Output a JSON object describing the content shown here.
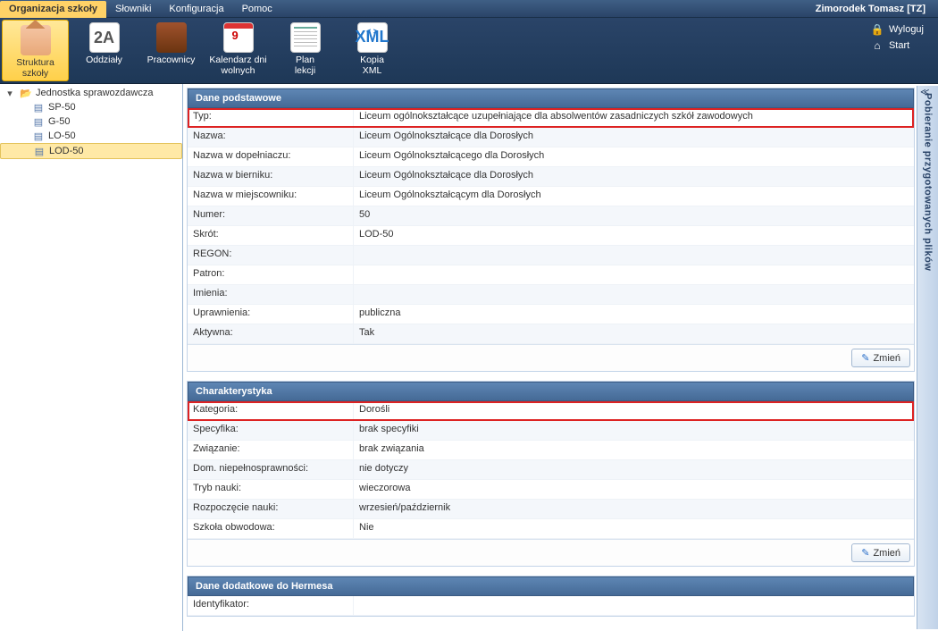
{
  "menu": {
    "tabs": [
      "Organizacja szkoły",
      "Słowniki",
      "Konfiguracja",
      "Pomoc"
    ],
    "active": 0
  },
  "user": "Zimorodek Tomasz [TZ]",
  "ribbon": {
    "buttons": [
      {
        "l1": "Struktura",
        "l2": "szkoły"
      },
      {
        "l1": "Oddziały",
        "l2": ""
      },
      {
        "l1": "Pracownicy",
        "l2": ""
      },
      {
        "l1": "Kalendarz dni",
        "l2": "wolnych"
      },
      {
        "l1": "Plan",
        "l2": "lekcji"
      },
      {
        "l1": "Kopia",
        "l2": "XML"
      }
    ],
    "links": {
      "logout": "Wyloguj",
      "start": "Start"
    }
  },
  "tree": {
    "root": "Jednostka sprawozdawcza",
    "items": [
      "SP-50",
      "G-50",
      "LO-50",
      "LOD-50"
    ],
    "selected": 3
  },
  "panels": {
    "basic": {
      "title": "Dane podstawowe",
      "rows": [
        {
          "label": "Typ:",
          "value": "Liceum ogólnokształcące uzupełniające dla absolwentów zasadniczych szkół zawodowych",
          "hl": true
        },
        {
          "label": "Nazwa:",
          "value": "Liceum Ogólnokształcące dla Dorosłych"
        },
        {
          "label": "Nazwa w dopełniaczu:",
          "value": "Liceum Ogólnokształcącego dla Dorosłych"
        },
        {
          "label": "Nazwa w bierniku:",
          "value": "Liceum Ogólnokształcące dla Dorosłych"
        },
        {
          "label": "Nazwa w miejscowniku:",
          "value": "Liceum Ogólnokształcącym dla Dorosłych"
        },
        {
          "label": "Numer:",
          "value": "50"
        },
        {
          "label": "Skrót:",
          "value": "LOD-50"
        },
        {
          "label": "REGON:",
          "value": ""
        },
        {
          "label": "Patron:",
          "value": ""
        },
        {
          "label": "Imienia:",
          "value": ""
        },
        {
          "label": "Uprawnienia:",
          "value": "publiczna"
        },
        {
          "label": "Aktywna:",
          "value": "Tak"
        }
      ],
      "button": "Zmień"
    },
    "char": {
      "title": "Charakterystyka",
      "rows": [
        {
          "label": "Kategoria:",
          "value": "Dorośli",
          "hl": true
        },
        {
          "label": "Specyfika:",
          "value": "brak specyfiki"
        },
        {
          "label": "Związanie:",
          "value": "brak związania"
        },
        {
          "label": "Dom. niepełnosprawności:",
          "value": "nie dotyczy"
        },
        {
          "label": "Tryb nauki:",
          "value": "wieczorowa"
        },
        {
          "label": "Rozpoczęcie nauki:",
          "value": "wrzesień/październik"
        },
        {
          "label": "Szkoła obwodowa:",
          "value": "Nie"
        }
      ],
      "button": "Zmień"
    },
    "hermes": {
      "title": "Dane dodatkowe do Hermesa",
      "rows": [
        {
          "label": "Identyfikator:",
          "value": ""
        }
      ]
    }
  },
  "sidetab": "Pobieranie przygotowanych plików"
}
